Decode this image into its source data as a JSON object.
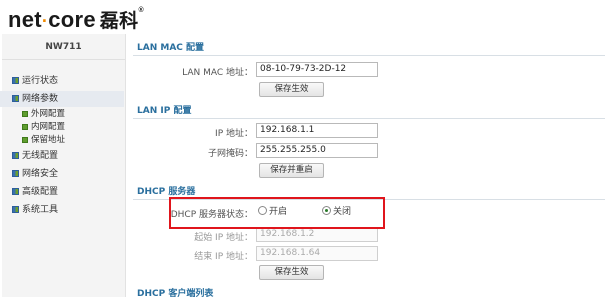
{
  "brand": {
    "logo_text": "net",
    "logo_dot": "·",
    "logo_text2": "core",
    "logo_cn": "磊科",
    "reg": "®"
  },
  "sidebar": {
    "model": "NW711",
    "items": [
      {
        "label": "运行状态",
        "icon": "grid-icon"
      },
      {
        "label": "网络参数",
        "icon": "grid-icon",
        "active": true
      },
      {
        "label": "无线配置",
        "icon": "grid-icon"
      },
      {
        "label": "网络安全",
        "icon": "grid-icon"
      },
      {
        "label": "高级配置",
        "icon": "grid-icon"
      },
      {
        "label": "系统工具",
        "icon": "grid-icon"
      }
    ],
    "subitems": [
      {
        "label": "外网配置",
        "icon": "square-icon"
      },
      {
        "label": "内网配置",
        "icon": "square-icon"
      },
      {
        "label": "保留地址",
        "icon": "square-icon"
      }
    ]
  },
  "lan_mac": {
    "title": "LAN MAC 配置",
    "label": "LAN MAC 地址：",
    "value": "08-10-79-73-2D-12",
    "save_button": "保存生效"
  },
  "lan_ip": {
    "title": "LAN IP 配置",
    "ip_label": "IP 地址：",
    "ip_value": "192.168.1.1",
    "mask_label": "子网掩码：",
    "mask_value": "255.255.255.0",
    "save_button": "保存并重启"
  },
  "dhcp": {
    "title": "DHCP 服务器",
    "status_label": "DHCP 服务器状态：",
    "option_on": "开启",
    "option_off": "关闭",
    "selected": "关闭",
    "start_label": "起始 IP 地址：",
    "start_value": "192.168.1.2",
    "end_label": "结束 IP 地址：",
    "end_value": "192.168.1.64",
    "save_button": "保存生效"
  },
  "next_section": {
    "title": "DHCP 客户端列表"
  },
  "colors": {
    "highlight": "#e0151c",
    "section_title": "#2a6f9e",
    "logo_dot": "#f08a00"
  }
}
